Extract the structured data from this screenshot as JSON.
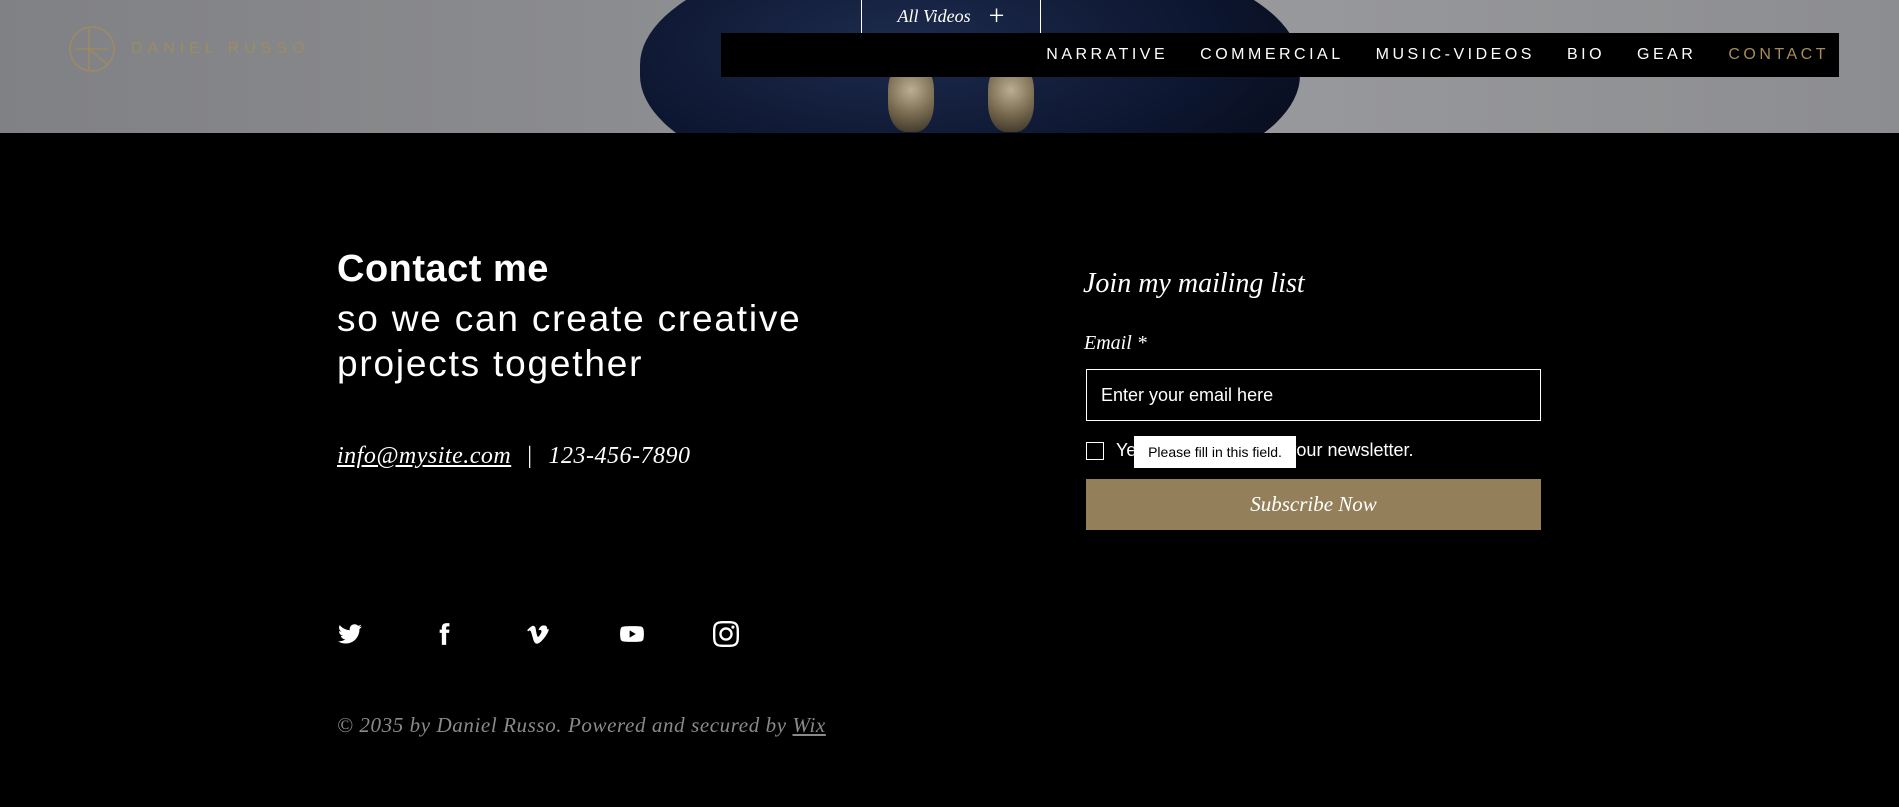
{
  "header": {
    "logo_text": "DANIEL RUSSO",
    "all_videos_label": "All Videos",
    "all_videos_plus": "+",
    "nav": [
      {
        "label": "NARRATIVE"
      },
      {
        "label": "COMMERCIAL"
      },
      {
        "label": "MUSIC-VIDEOS"
      },
      {
        "label": "BIO"
      },
      {
        "label": "GEAR"
      },
      {
        "label": "CONTACT",
        "active": true
      }
    ]
  },
  "contact": {
    "title": "Contact me",
    "subtitle": "so we can create creative projects together",
    "email": "info@mysite.com",
    "separator": "|",
    "phone": "123-456-7890"
  },
  "socials": [
    {
      "icon": "twitter-icon"
    },
    {
      "icon": "facebook-icon"
    },
    {
      "icon": "vimeo-icon"
    },
    {
      "icon": "youtube-icon"
    },
    {
      "icon": "instagram-icon"
    }
  ],
  "footer": {
    "copyright": "© 2035 by Daniel Russo. Powered and secured by",
    "wix_link": "Wix"
  },
  "mailing": {
    "title": "Join my mailing list",
    "email_label": "Email *",
    "email_placeholder": "Enter your email here",
    "email_value": "",
    "checkbox_label": "Yes, subscribe me to your newsletter.",
    "checkbox_checked": false,
    "tooltip": "Please fill in this field.",
    "subscribe_label": "Subscribe Now"
  },
  "colors": {
    "accent": "#a78c5a",
    "button": "#93805b",
    "background": "#000000"
  }
}
